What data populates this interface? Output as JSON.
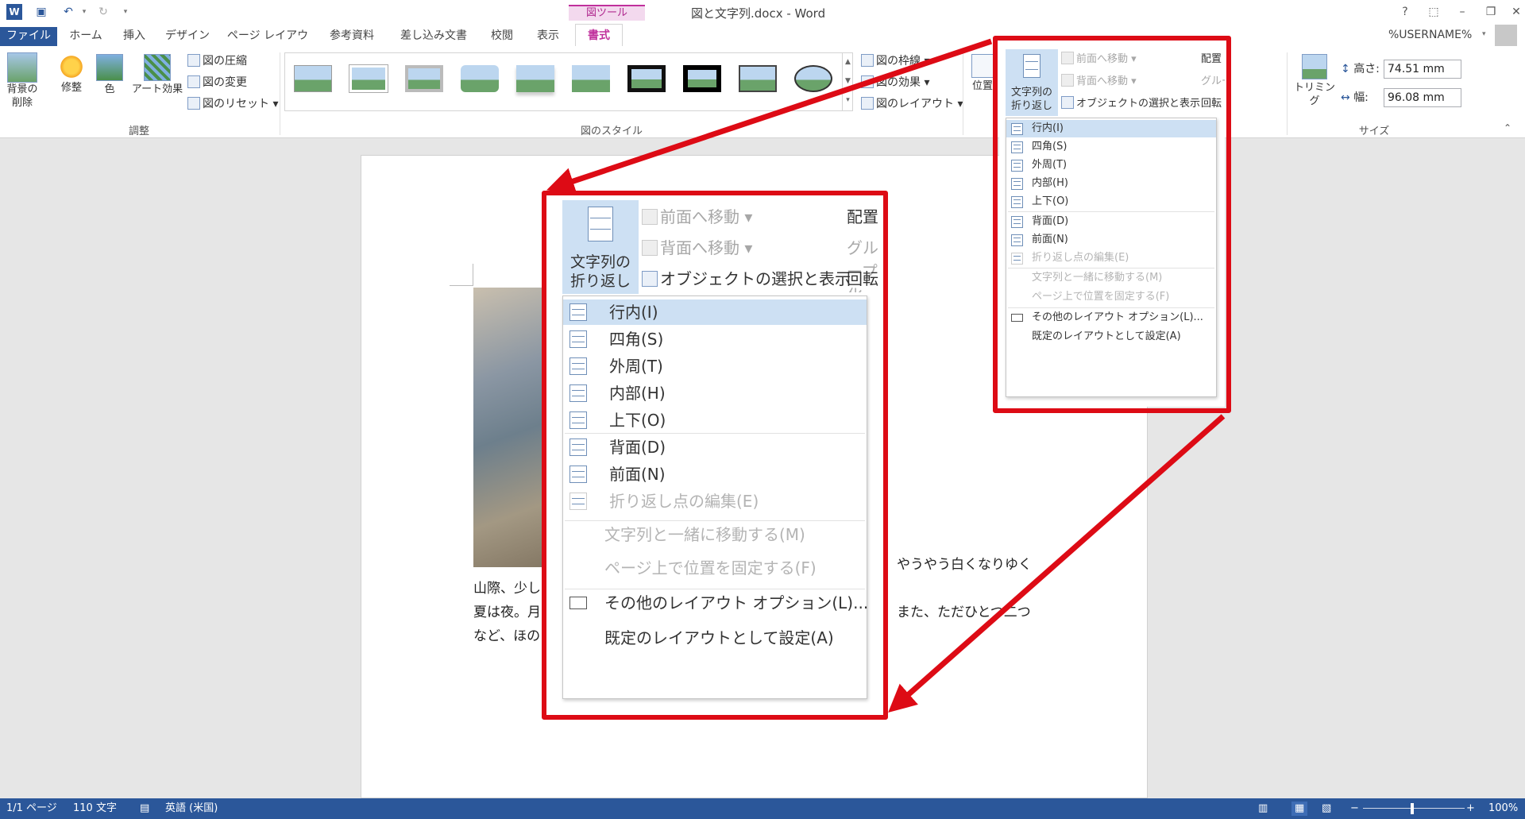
{
  "window": {
    "title": "図と文字列.docx - Word",
    "context_tab_group": "図ツール",
    "help": "?",
    "user": "%USERNAME%"
  },
  "tabs": [
    "ファイル",
    "ホーム",
    "挿入",
    "デザイン",
    "ページ レイアウト",
    "参考資料",
    "差し込み文書",
    "校閲",
    "表示",
    "書式"
  ],
  "ribbon": {
    "adjust": {
      "remove_bg": "背景の\n削除",
      "corrections": "修整",
      "color": "色",
      "art_effects": "アート効果",
      "compress": "図の圧縮",
      "change": "図の変更",
      "reset": "図のリセット",
      "group_label": "調整"
    },
    "styles": {
      "border": "図の枠線",
      "effects": "図の効果",
      "layout": "図のレイアウト",
      "group_label": "図のスタイル"
    },
    "arrange": {
      "position": "位置",
      "wrap_text": "文字列の\n折り返し",
      "bring_forward": "前面へ移動",
      "send_backward": "背面へ移動",
      "selection_pane": "オブジェクトの選択と表示",
      "align": "配置",
      "group": "グループ化",
      "rotate": "回転"
    },
    "size": {
      "crop": "トリミング",
      "height_label": "高さ:",
      "height_value": "74.51 mm",
      "width_label": "幅:",
      "width_value": "96.08 mm",
      "group_label": "サイズ"
    }
  },
  "wrap_menu": {
    "items": [
      {
        "label": "行内(I)",
        "disabled": false,
        "highlighted": true
      },
      {
        "label": "四角(S)",
        "disabled": false
      },
      {
        "label": "外周(T)",
        "disabled": false
      },
      {
        "label": "内部(H)",
        "disabled": false
      },
      {
        "label": "上下(O)",
        "disabled": false
      },
      {
        "label": "背面(D)",
        "disabled": false
      },
      {
        "label": "前面(N)",
        "disabled": false
      },
      {
        "label": "折り返し点の編集(E)",
        "disabled": true
      },
      {
        "label": "文字列と一緒に移動する(M)",
        "disabled": true
      },
      {
        "label": "ページ上で位置を固定する(F)",
        "disabled": true
      },
      {
        "label": "その他のレイアウト オプション(L)...",
        "disabled": false
      },
      {
        "label": "既定のレイアウトとして設定(A)",
        "disabled": false
      }
    ]
  },
  "document": {
    "line1_end": "。やうやう白くなりゆく",
    "line2_start": "山際、少し",
    "line3_start": "夏は夜。月",
    "line3_end": "。また、ただひとつ二つ",
    "line4_start": "など、ほの"
  },
  "status": {
    "page": "1/1 ページ",
    "words": "110 文字",
    "language": "英語 (米国)",
    "zoom": "100%"
  },
  "colors": {
    "accent": "#2b579a",
    "context_tab": "#c0309c",
    "highlight": "#cde0f3",
    "callout_red": "#dd0b15"
  }
}
